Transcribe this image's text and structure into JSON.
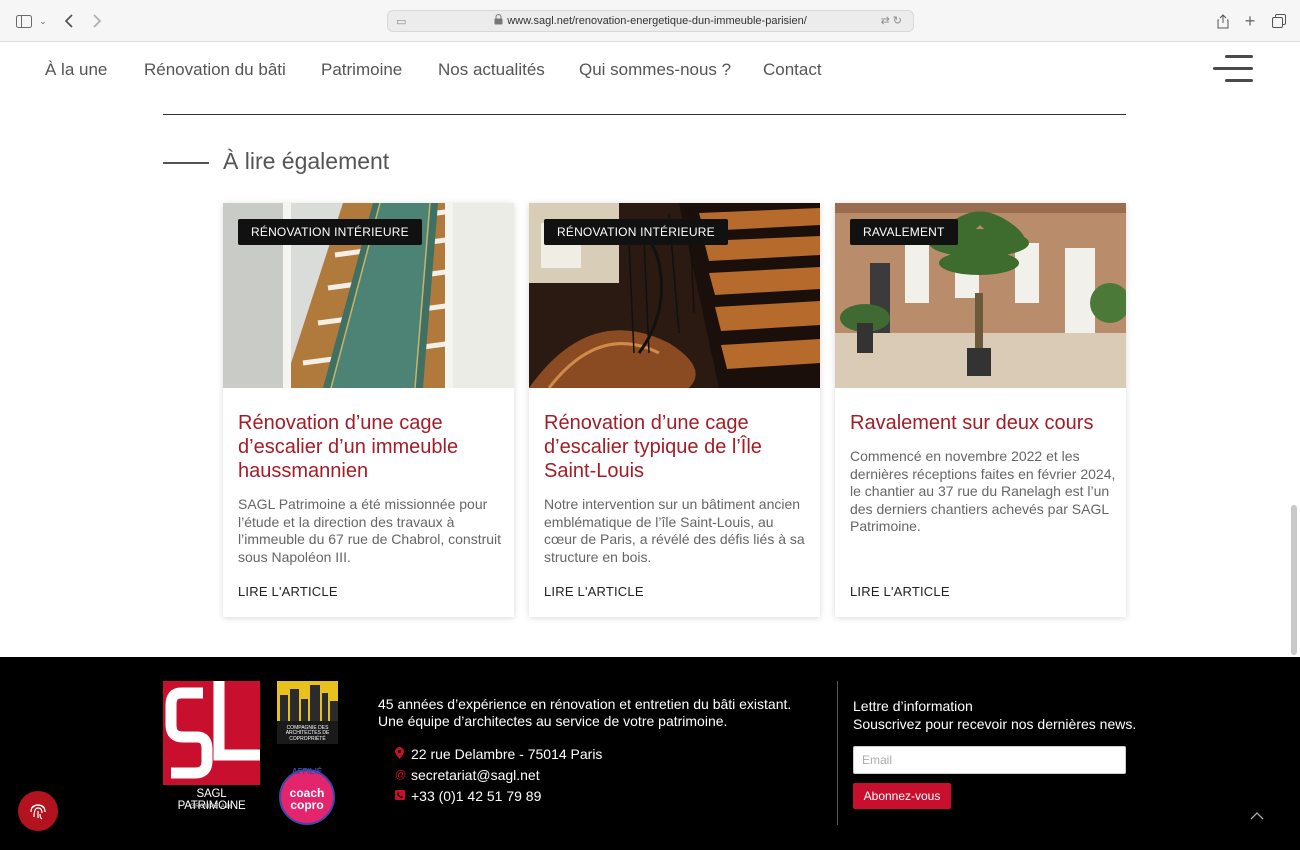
{
  "browser": {
    "url": "www.sagl.net/renovation-energetique-dun-immeuble-parisien/"
  },
  "nav": {
    "items": [
      "À la une",
      "Rénovation du bâti",
      "Patrimoine",
      "Nos actualités",
      "Qui sommes-nous ?",
      "Contact"
    ]
  },
  "section": {
    "title": "À lire également"
  },
  "cards": [
    {
      "badge": "RÉNOVATION INTÉRIEURE",
      "title": "Rénovation d’une cage d’escalier d’un immeuble haussmannien",
      "text": "SAGL Patrimoine a été missionnée pour l’étude et la direction des travaux à l’immeuble du 67 rue de Chabrol, construit sous Napoléon III.",
      "link": "LIRE L'ARTICLE"
    },
    {
      "badge": "RÉNOVATION INTÉRIEURE",
      "title": "Rénovation d’une cage d’escalier typique de l’Île Saint-Louis",
      "text": "Notre intervention sur un bâtiment ancien emblématique de l’île Saint-Louis, au cœur de Paris, a révélé des défis liés à sa structure en bois.",
      "link": "LIRE L'ARTICLE"
    },
    {
      "badge": "RAVALEMENT",
      "title": "Ravalement sur deux cours",
      "text": "Commencé en novembre 2022 et les dernières réceptions faites en février 2024, le chantier au 37 rue du Ranelagh est l’un des derniers chantiers achevés par SAGL Patrimoine.",
      "link": "LIRE L'ARTICLE"
    }
  ],
  "footer": {
    "logo_name": "SAGL PATRIMOINE",
    "logo_sub": "GROUPE A26",
    "cie_text": "COMPAGNIE DES ARCHITECTES DE COPROPRIÉTÉ",
    "coach_top": "AFFILIÉ",
    "coach_line1": "coach",
    "coach_line2": "copro",
    "tagline_1": "45 années d’expérience en rénovation et entretien du bâti existant.",
    "tagline_2": "Une équipe d’architectes au service de votre patrimoine.",
    "address": "22 rue Delambre - 75014 Paris",
    "email": "secretariat@sagl.net",
    "phone": "+33 (0)1 42 51 79 89",
    "newsletter_title": "Lettre d’information",
    "newsletter_text": "Souscrivez pour recevoir nos dernières news.",
    "email_placeholder": "Email",
    "subscribe_label": "Abonnez-vous"
  },
  "colors": {
    "accent": "#a51c26",
    "brand_red": "#c8102e",
    "footer_bg": "#000000"
  }
}
